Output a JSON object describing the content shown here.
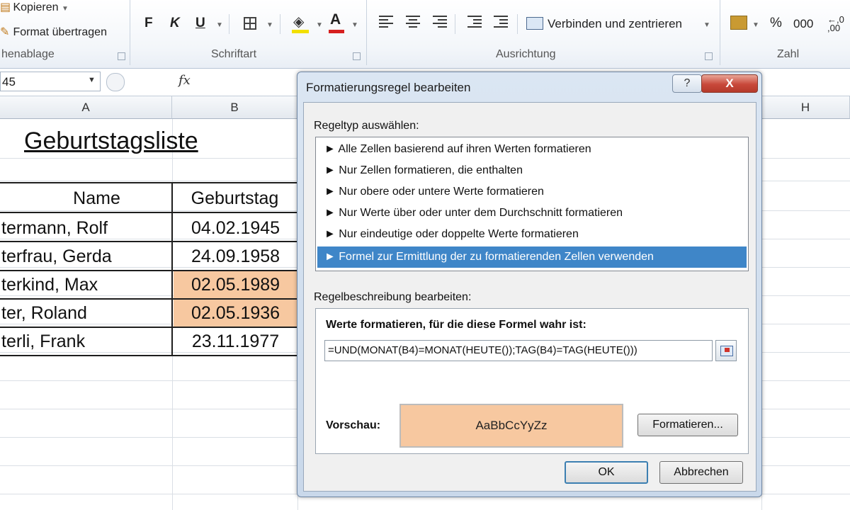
{
  "ribbon": {
    "clipboard": {
      "copy": "Kopieren",
      "format_painter": "Format übertragen",
      "group": "henablage"
    },
    "font": {
      "bold": "F",
      "italic": "K",
      "underline": "U",
      "group": "Schriftart",
      "font_color_letter": "A"
    },
    "alignment": {
      "merge_center": "Verbinden und zentrieren",
      "group": "Ausrichtung"
    },
    "number": {
      "percent": "%",
      "thousands": "000",
      "group": "Zahl"
    }
  },
  "formula_bar": {
    "name_box": "45",
    "fx": "fx"
  },
  "sheet": {
    "columns": [
      "A",
      "B",
      "H"
    ],
    "title": "Geburtstagsliste",
    "headers": {
      "name": "Name",
      "birthday": "Geburtstag"
    },
    "rows": [
      {
        "name": "termann, Rolf",
        "birthday": "04.02.1945",
        "highlight": false
      },
      {
        "name": "terfrau, Gerda",
        "birthday": "24.09.1958",
        "highlight": false
      },
      {
        "name": "terkind, Max",
        "birthday": "02.05.1989",
        "highlight": true
      },
      {
        "name": "ter, Roland",
        "birthday": "02.05.1936",
        "highlight": true
      },
      {
        "name": "terli, Frank",
        "birthday": "23.11.1977",
        "highlight": false
      }
    ],
    "highlight_color": "#f7c8a0"
  },
  "dialog": {
    "title": "Formatierungsregel bearbeiten",
    "help": "?",
    "close": "X",
    "rule_type_label": "Regeltyp auswählen:",
    "rules": [
      "► Alle Zellen basierend auf ihren Werten formatieren",
      "► Nur Zellen formatieren, die enthalten",
      "► Nur obere oder untere Werte formatieren",
      "► Nur Werte über oder unter dem Durchschnitt formatieren",
      "► Nur eindeutige oder doppelte Werte formatieren",
      "► Formel zur Ermittlung der zu formatierenden Zellen verwenden"
    ],
    "selected_rule_index": 5,
    "description_label": "Regelbeschreibung bearbeiten:",
    "formula_title": "Werte formatieren, für die diese Formel wahr ist:",
    "formula": "=UND(MONAT(B4)=MONAT(HEUTE());TAG(B4)=TAG(HEUTE()))",
    "preview_label": "Vorschau:",
    "preview_text": "AaBbCcYyZz",
    "preview_color": "#f7c8a0",
    "format_button": "Formatieren...",
    "ok": "OK",
    "cancel": "Abbrechen"
  }
}
